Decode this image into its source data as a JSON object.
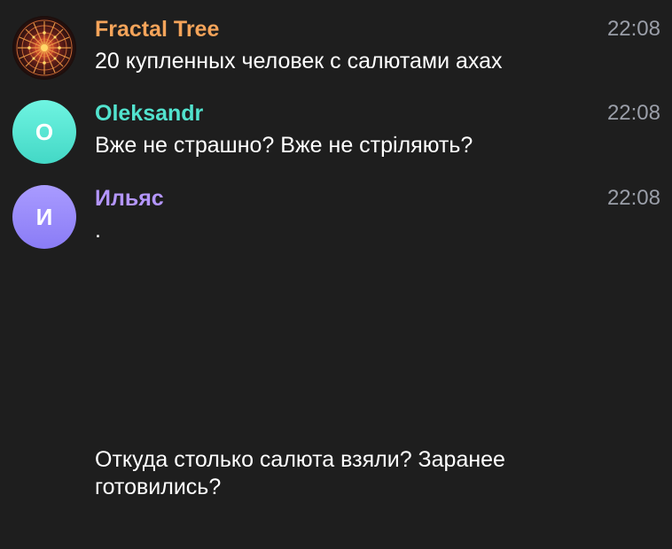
{
  "messages": [
    {
      "sender": "Fractal Tree",
      "sender_color": "#f5a45a",
      "time": "22:08",
      "text": "20 купленных человек с салютами ахах",
      "avatar": {
        "type": "image",
        "icon": "fractal-mandala-icon"
      }
    },
    {
      "sender": "Oleksandr",
      "sender_color": "#52e3ce",
      "time": "22:08",
      "text": "Вже не страшно? Вже не стріляють?",
      "avatar": {
        "type": "letter",
        "letter": "O",
        "color": "#5de8d5"
      }
    },
    {
      "sender": "Ильяс",
      "sender_color": "#b496ff",
      "time": "22:08",
      "text": ".",
      "avatar": {
        "type": "letter",
        "letter": "И",
        "color": "#9a8cff"
      }
    }
  ],
  "continuation": {
    "text": "Откуда столько салюта взяли? Заранее готовились?"
  }
}
